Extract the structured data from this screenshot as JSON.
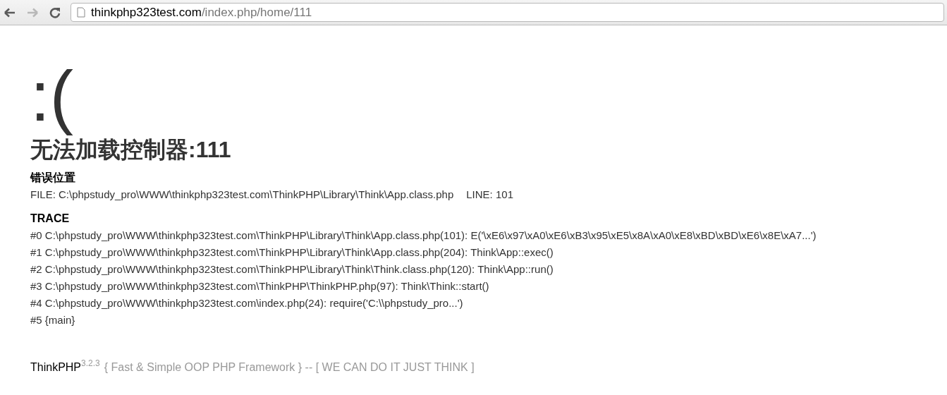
{
  "browser": {
    "back_disabled": false,
    "forward_disabled": true,
    "url_host": "thinkphp323test.com",
    "url_path": "/index.php/home/111"
  },
  "face": ":(",
  "title": "无法加载控制器:111",
  "location": {
    "heading": "错误位置",
    "file": "FILE: C:\\phpstudy_pro\\WWW\\thinkphp323test.com\\ThinkPHP\\Library\\Think\\App.class.php",
    "line": "LINE: 101"
  },
  "trace": {
    "heading": "TRACE",
    "lines": [
      "#0 C:\\phpstudy_pro\\WWW\\thinkphp323test.com\\ThinkPHP\\Library\\Think\\App.class.php(101): E('\\xE6\\x97\\xA0\\xE6\\xB3\\x95\\xE5\\x8A\\xA0\\xE8\\xBD\\xBD\\xE6\\x8E\\xA7...')",
      "#1 C:\\phpstudy_pro\\WWW\\thinkphp323test.com\\ThinkPHP\\Library\\Think\\App.class.php(204): Think\\App::exec()",
      "#2 C:\\phpstudy_pro\\WWW\\thinkphp323test.com\\ThinkPHP\\Library\\Think\\Think.class.php(120): Think\\App::run()",
      "#3 C:\\phpstudy_pro\\WWW\\thinkphp323test.com\\ThinkPHP\\ThinkPHP.php(97): Think\\Think::start()",
      "#4 C:\\phpstudy_pro\\WWW\\thinkphp323test.com\\index.php(24): require('C:\\\\phpstudy_pro...')",
      "#5 {main}"
    ]
  },
  "footer": {
    "brand": "ThinkPHP",
    "version": "3.2.3",
    "slogan": "{ Fast & Simple OOP PHP Framework } -- [ WE CAN DO IT JUST THINK ]"
  }
}
